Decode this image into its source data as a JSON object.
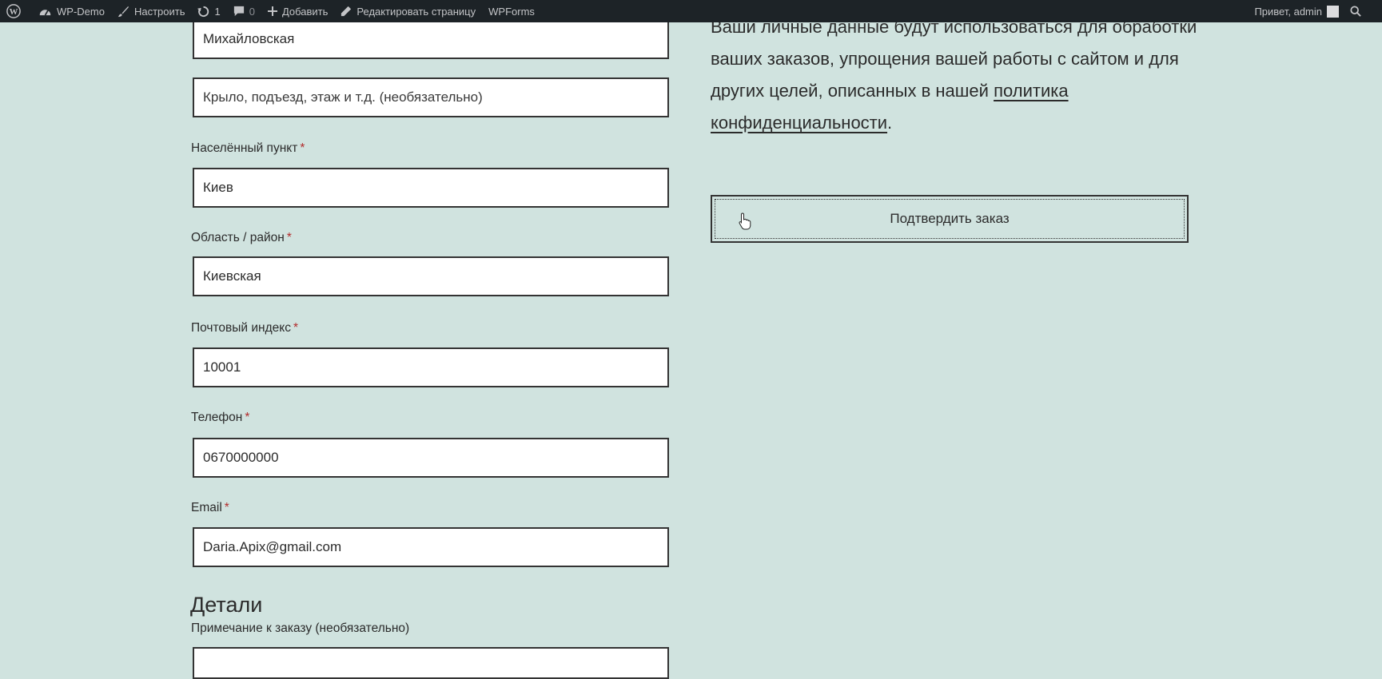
{
  "adminbar": {
    "site_name": "WP-Demo",
    "customize": "Настроить",
    "updates_count": "1",
    "comments_count": "0",
    "add_new": "Добавить",
    "edit_page": "Редактировать страницу",
    "wpforms": "WPForms",
    "greeting": "Привет, admin"
  },
  "form": {
    "street_value": "Михайловская",
    "address2_placeholder": "Крыло, подъезд, этаж и т.д. (необязательно)",
    "city_label": "Населённый пункт",
    "city_value": "Киев",
    "state_label": "Область / район",
    "state_value": "Киевская",
    "postcode_label": "Почтовый индекс",
    "postcode_value": "10001",
    "phone_label": "Телефон",
    "phone_value": "0670000000",
    "email_label": "Email",
    "email_value": "Daria.Apix@gmail.com",
    "required_mark": "*",
    "details_heading": "Детали",
    "order_notes_label": "Примечание к заказу (необязательно)"
  },
  "sidebar": {
    "privacy_text": "Ваши личные данные будут использоваться для обработки ваших заказов, упрощения вашей работы с сайтом и для других целей, описанных в нашей",
    "privacy_link": "политика конфиденциальности",
    "privacy_end": ".",
    "confirm_button": "Подтвердить заказ"
  },
  "icons": [
    "wordpress-icon",
    "dashboard-icon",
    "brush-icon",
    "refresh-icon",
    "comment-icon",
    "plus-icon",
    "pencil-icon",
    "hand-cursor-icon"
  ]
}
